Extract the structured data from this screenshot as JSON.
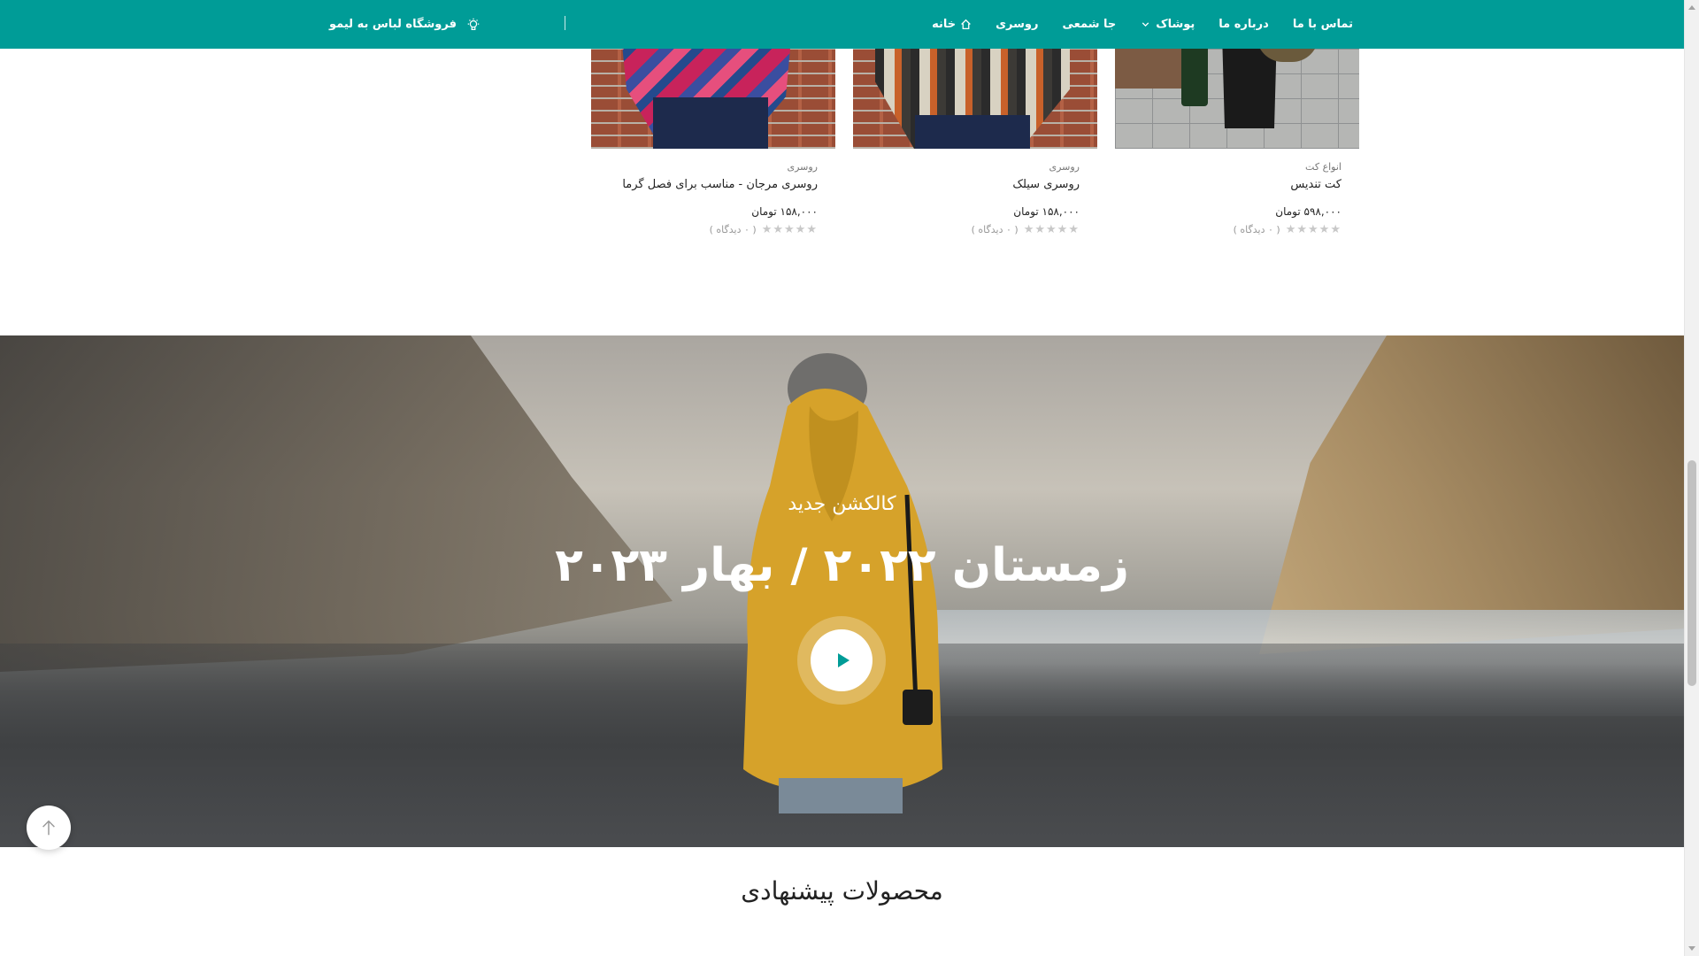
{
  "nav": {
    "items": [
      {
        "label": "خانه",
        "icon": "home-icon"
      },
      {
        "label": "روسری"
      },
      {
        "label": "جا شمعی"
      },
      {
        "label": "پوشاک",
        "icon": "chevron-down-icon"
      },
      {
        "label": "درباره ما"
      },
      {
        "label": "تماس با ما"
      }
    ],
    "brand": "فروشگاه لباس به لیمو",
    "brand_icon": "lightbulb-icon",
    "accent_color": "#009c97"
  },
  "products": [
    {
      "category": "انواع کت",
      "title": "کت تندیس",
      "price": "۵۹۸,۰۰۰ تومان",
      "views": "( ۰ دیدگاه )",
      "rating": 0
    },
    {
      "category": "روسری",
      "title": "روسری سیلک",
      "price": "۱۵۸,۰۰۰ تومان",
      "views": "( ۰ دیدگاه )",
      "rating": 0
    },
    {
      "category": "روسری",
      "title": "روسری مرجان - مناسب برای فصل گرما",
      "price": "۱۵۸,۰۰۰ تومان",
      "views": "( ۰ دیدگاه )",
      "rating": 0
    }
  ],
  "hero": {
    "subtitle": "کالکشن جدید",
    "title": "زمستان ۲۰۲۲ / بهار ۲۰۲۳",
    "play_icon": "play-icon"
  },
  "recommended": {
    "title": "محصولات پیشنهادی"
  },
  "scroll_top_icon": "arrow-up-icon"
}
